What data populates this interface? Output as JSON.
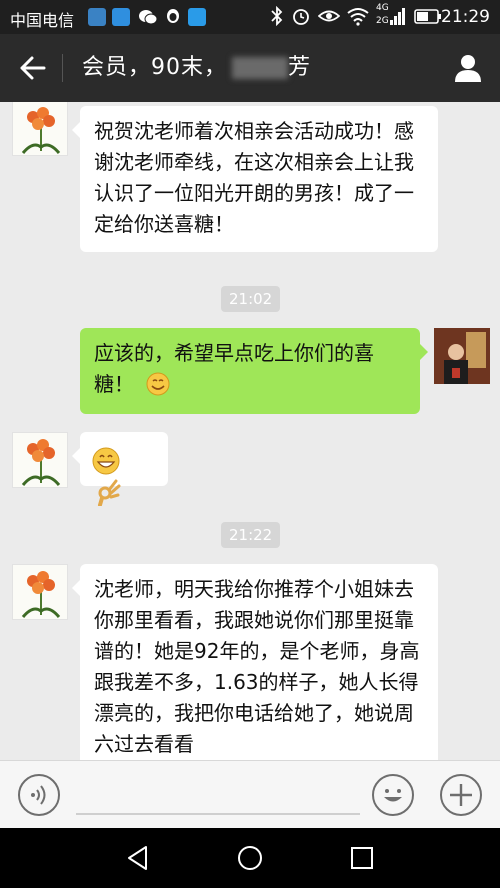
{
  "status_bar": {
    "carrier": "中国电信",
    "time": "21:29",
    "network_label_top": "4G",
    "network_label_bottom": "2G",
    "icons": [
      "bluetooth-icon",
      "alarm-icon",
      "eye-icon",
      "wifi-icon",
      "signal-icon",
      "battery-icon"
    ]
  },
  "header": {
    "title": "会员，90末，",
    "title_suffix": "芳",
    "icons": [
      "back-arrow-icon",
      "contact-profile-icon"
    ]
  },
  "messages": [
    {
      "side": "in",
      "text": "祝贺沈老师着次相亲会活动成功！感谢沈老师牵线，在这次相亲会上让我认识了一位阳光开朗的男孩！成了一定给你送喜糖！"
    },
    {
      "timestamp": "21:02"
    },
    {
      "side": "out",
      "text": "应该的，希望早点吃上你们的喜糖！",
      "emoji": "smile-emoji-icon"
    },
    {
      "side": "in",
      "emoji": [
        "grin-emoji-icon",
        "ok-hand-emoji-icon"
      ]
    },
    {
      "timestamp": "21:22"
    },
    {
      "side": "in",
      "text": "沈老师，明天我给你推荐个小姐妹去你那里看看，我跟她说你们那里挺靠谱的！她是92年的，是个老师，身高跟我差不多，1.63的样子，她人长得漂亮的，我把你电话给她了，她说周六过去看看"
    }
  ],
  "input_bar": {
    "icons": [
      "voice-icon",
      "emoji-picker-icon",
      "more-plus-icon"
    ]
  },
  "nav_bar": {
    "icons": [
      "nav-back-icon",
      "nav-home-icon",
      "nav-recents-icon"
    ]
  },
  "colors": {
    "status_bg": "#1f1f1f",
    "title_bg": "#2b2b2b",
    "chat_bg": "#ebebeb",
    "bubble_in": "#ffffff",
    "bubble_out": "#9fe658",
    "timestamp_bg": "#d6d6d6"
  }
}
